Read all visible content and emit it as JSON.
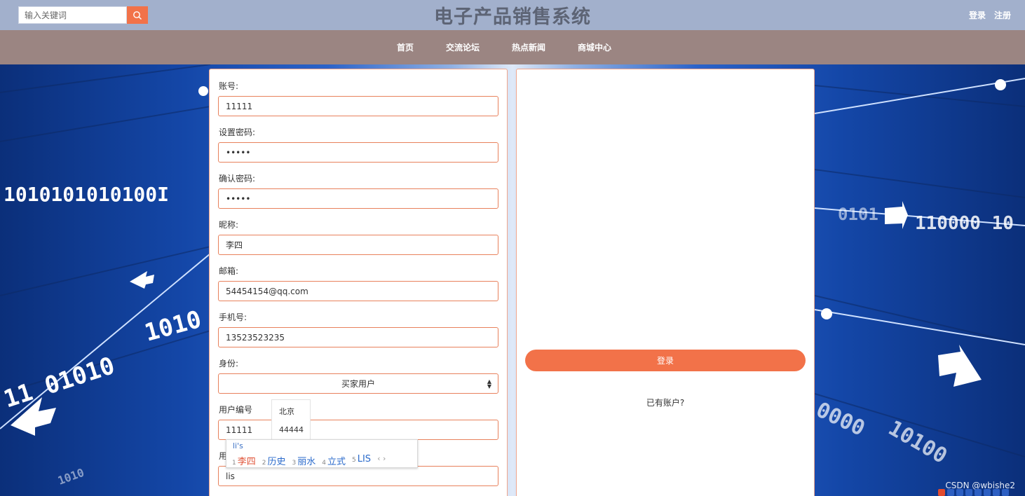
{
  "header": {
    "search_placeholder": "输入关键词",
    "title": "电子产品销售系统",
    "login": "登录",
    "register": "注册"
  },
  "nav": [
    "首页",
    "交流论坛",
    "热点新闻",
    "商城中心"
  ],
  "background_text": [
    "1010101010100I",
    "1010",
    "11 01010",
    "0101",
    "110000 10",
    "0000",
    "10100",
    "1010"
  ],
  "form": {
    "account": {
      "label": "账号:",
      "value": "11111"
    },
    "password": {
      "label": "设置密码:",
      "value": "•••••"
    },
    "confirm": {
      "label": "确认密码:",
      "value": "•••••"
    },
    "nickname": {
      "label": "昵称:",
      "value": "李四"
    },
    "email": {
      "label": "邮箱:",
      "value": "54454154@qq.com"
    },
    "phone": {
      "label": "手机号:",
      "value": "13523523235"
    },
    "identity": {
      "label": "身份:",
      "value": "买家用户"
    },
    "user_no": {
      "label": "用户编号",
      "value": "11111"
    },
    "name": {
      "label": "用",
      "value": "lis"
    }
  },
  "autocomplete": [
    "北京",
    "44444"
  ],
  "ime": {
    "pinyin": "li's",
    "candidates": [
      {
        "num": "1",
        "text": "李四"
      },
      {
        "num": "2",
        "text": "历史"
      },
      {
        "num": "3",
        "text": "丽水"
      },
      {
        "num": "4",
        "text": "立式"
      },
      {
        "num": "5",
        "text": "LIS"
      }
    ],
    "nav": "‹  ›"
  },
  "side": {
    "have_account": "已有账户?",
    "login_button": "登录"
  },
  "watermark": "CSDN @wbishe2",
  "colors": {
    "accent": "#f27249",
    "topbar": "#a2b0cc",
    "navbar": "#9b8582",
    "border": "#e8815c"
  }
}
